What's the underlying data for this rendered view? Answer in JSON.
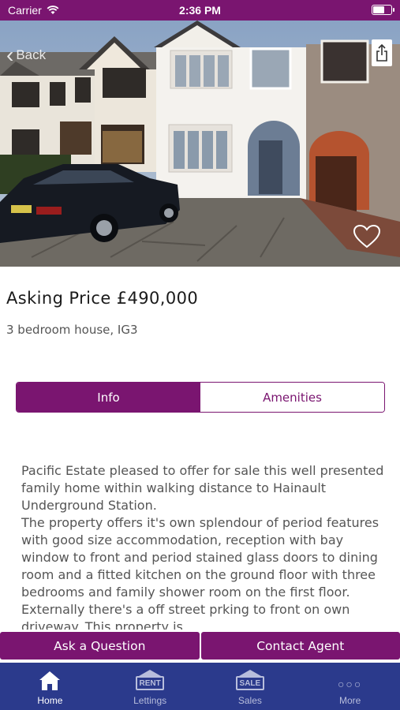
{
  "status_bar": {
    "carrier": "Carrier",
    "time": "2:36 PM"
  },
  "nav": {
    "back_label": "Back"
  },
  "listing": {
    "price": "Asking Price £490,000",
    "subtitle": "3 bedroom house, IG3"
  },
  "tabs": [
    {
      "label": "Info",
      "active": true
    },
    {
      "label": "Amenities",
      "active": false
    }
  ],
  "description": {
    "paragraph1": "Pacific Estate pleased to offer for sale this well presented family home within walking distance to Hainault Underground Station.",
    "paragraph2": "The property offers it's own splendour of period features with good size accommodation, reception with bay window to front and period stained glass doors to dining room and a fitted kitchen on the ground floor with three bedrooms and family shower room on the first floor. Externally there's a off street prking to front on own driveway. This property is"
  },
  "actions": {
    "ask_label": "Ask a Question",
    "contact_label": "Contact Agent"
  },
  "tabbar": {
    "items": [
      {
        "label": "Home",
        "icon": "home-icon",
        "badge": ""
      },
      {
        "label": "Lettings",
        "icon": "rent-sign-icon",
        "badge": "RENT"
      },
      {
        "label": "Sales",
        "icon": "sale-sign-icon",
        "badge": "SALE"
      },
      {
        "label": "More",
        "icon": "more-icon",
        "badge": ""
      }
    ]
  },
  "colors": {
    "brand_purple": "#7a1570",
    "tabbar_blue": "#2b3a8c"
  }
}
